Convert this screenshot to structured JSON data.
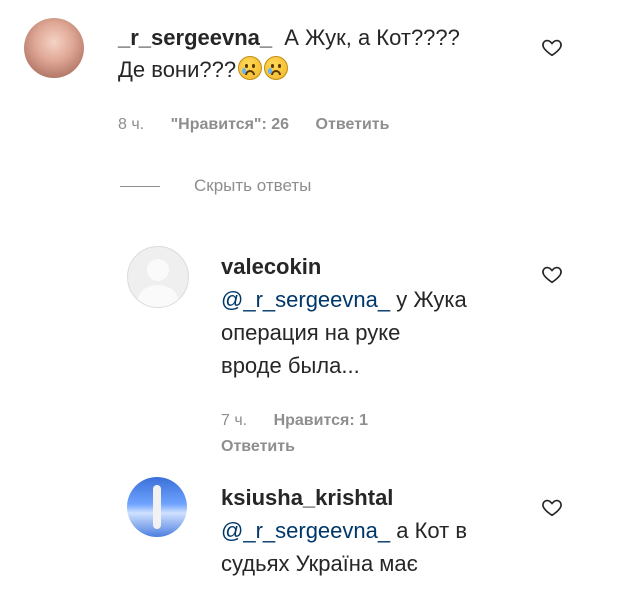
{
  "comments": [
    {
      "username": "_r_sergeevna_",
      "text": "А Жук, а Кот???? Де вони???",
      "text_line1": "А Жук, а Кот????",
      "text_line2": "Де вони???",
      "emoji": [
        "crying-face",
        "crying-face"
      ],
      "time": "8 ч.",
      "likes": "\"Нравится\": 26",
      "reply": "Ответить"
    },
    {
      "username": "valecokin",
      "mention": "@_r_sergeevna_",
      "text_line1_rest": " у Жука",
      "text_line2": "операция на руке",
      "text_line3": "вроде была...",
      "time": "7 ч.",
      "likes": "Нравится: 1",
      "reply": "Ответить"
    },
    {
      "username": "ksiusha_krishtal",
      "mention": "@_r_sergeevna_",
      "text_line1_rest": " а Кот в",
      "text_line2": "судьях Україна має"
    }
  ],
  "hide_replies": "Скрыть ответы",
  "colors": {
    "meta": "#8e8e8e",
    "mention": "#00376b",
    "text": "#262626"
  },
  "icons": [
    "heart-icon",
    "crying-face-emoji"
  ]
}
